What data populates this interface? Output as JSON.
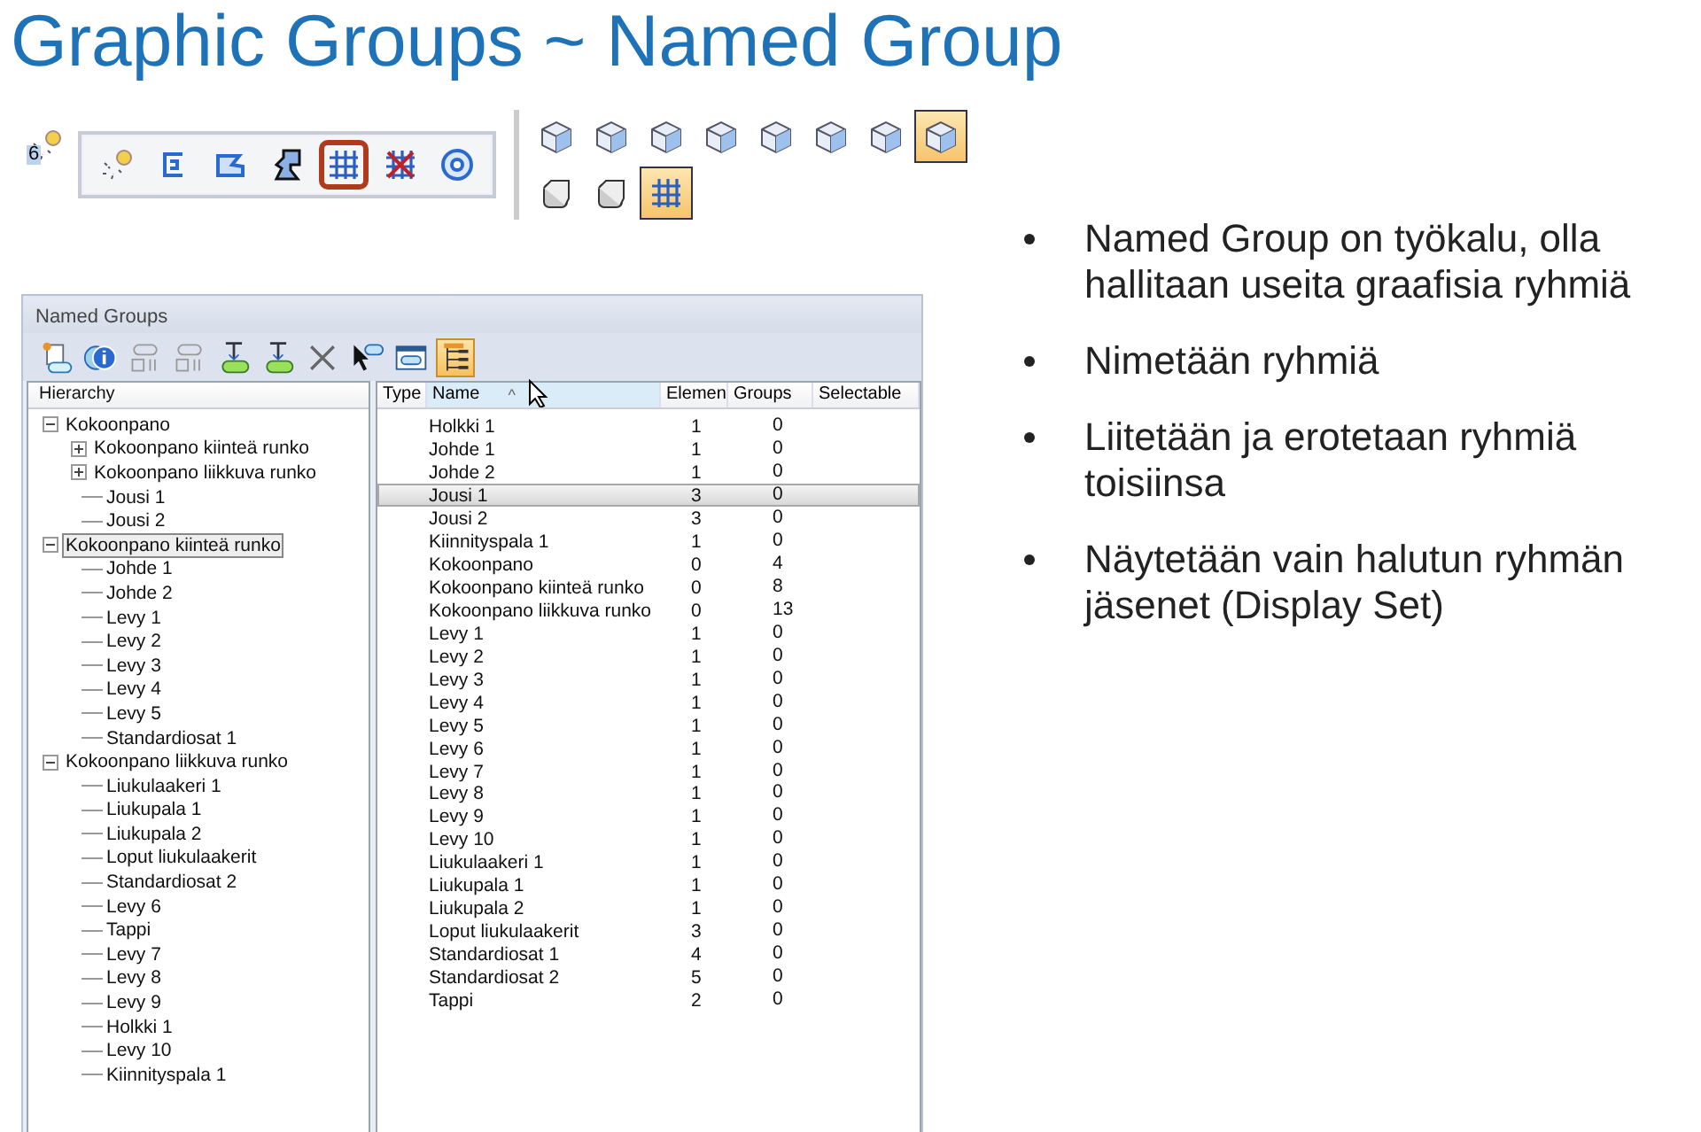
{
  "slide_title": "Graphic Groups ~ Named Group",
  "toolbar": {
    "badge": "6",
    "tools": [
      {
        "kind": "bulb",
        "selected": false
      },
      {
        "kind": "bracket",
        "selected": false
      },
      {
        "kind": "profile",
        "selected": false
      },
      {
        "kind": "figure",
        "selected": false
      },
      {
        "kind": "grid",
        "selected": true
      },
      {
        "kind": "grid-crossed",
        "selected": false
      },
      {
        "kind": "ring",
        "selected": false
      }
    ]
  },
  "view_palette": [
    {
      "kind": "cube",
      "selected": false
    },
    {
      "kind": "cube",
      "selected": false
    },
    {
      "kind": "cube",
      "selected": false
    },
    {
      "kind": "cube",
      "selected": false
    },
    {
      "kind": "cube",
      "selected": false
    },
    {
      "kind": "cube",
      "selected": false
    },
    {
      "kind": "cube",
      "selected": false
    },
    {
      "kind": "cube",
      "selected": true
    },
    {
      "kind": "rounded-cube",
      "selected": false
    },
    {
      "kind": "rounded-cube",
      "selected": false
    },
    {
      "kind": "grid",
      "selected": true
    }
  ],
  "window": {
    "title": "Named Groups",
    "toolbar": [
      {
        "kind": "new",
        "selected": false
      },
      {
        "kind": "info",
        "selected": false
      },
      {
        "kind": "links",
        "selected": false
      },
      {
        "kind": "links",
        "selected": false
      },
      {
        "kind": "add",
        "selected": false
      },
      {
        "kind": "add",
        "selected": false
      },
      {
        "kind": "delete",
        "selected": false
      },
      {
        "kind": "pointer",
        "selected": false
      },
      {
        "kind": "window",
        "selected": false
      },
      {
        "kind": "hierarchy",
        "selected": true
      }
    ],
    "tree": {
      "header": "Hierarchy",
      "items": [
        {
          "label": "Kokoonpano",
          "expanded": true,
          "selected": false,
          "children": [
            {
              "label": "Kokoonpano kiinteä runko",
              "expanded": false,
              "selected": false
            },
            {
              "label": "Kokoonpano liikkuva runko",
              "expanded": false,
              "selected": false
            },
            {
              "label": "Jousi 1",
              "selected": false
            },
            {
              "label": "Jousi 2",
              "selected": false
            }
          ]
        },
        {
          "label": "Kokoonpano kiinteä runko",
          "expanded": true,
          "selected": true,
          "children": [
            {
              "label": "Johde 1",
              "selected": false
            },
            {
              "label": "Johde 2",
              "selected": false
            },
            {
              "label": "Levy 1",
              "selected": false
            },
            {
              "label": "Levy 2",
              "selected": false
            },
            {
              "label": "Levy 3",
              "selected": false
            },
            {
              "label": "Levy 4",
              "selected": false
            },
            {
              "label": "Levy 5",
              "selected": false
            },
            {
              "label": "Standardiosat 1",
              "selected": false
            }
          ]
        },
        {
          "label": "Kokoonpano liikkuva runko",
          "expanded": true,
          "selected": false,
          "children": [
            {
              "label": "Liukulaakeri 1",
              "selected": false
            },
            {
              "label": "Liukupala 1",
              "selected": false
            },
            {
              "label": "Liukupala 2",
              "selected": false
            },
            {
              "label": "Loput liukulaakerit",
              "selected": false
            },
            {
              "label": "Standardiosat 2",
              "selected": false
            },
            {
              "label": "Levy 6",
              "selected": false
            },
            {
              "label": "Tappi",
              "selected": false
            },
            {
              "label": "Levy 7",
              "selected": false
            },
            {
              "label": "Levy 8",
              "selected": false
            },
            {
              "label": "Levy 9",
              "selected": false
            },
            {
              "label": "Holkki 1",
              "selected": false
            },
            {
              "label": "Levy 10",
              "selected": false
            },
            {
              "label": "Kiinnityspala 1",
              "selected": false
            }
          ]
        }
      ]
    },
    "table": {
      "columns": [
        {
          "label": "Type",
          "sorted": false
        },
        {
          "label": "Name",
          "sorted": true,
          "sort_mark": "^"
        },
        {
          "label": "Elemen",
          "sorted": false
        },
        {
          "label": "Groups",
          "sorted": false
        },
        {
          "label": "Selectable",
          "sorted": false
        }
      ],
      "rows": [
        {
          "name": "Holkki 1",
          "elements": "1",
          "groups": "0",
          "selected": false
        },
        {
          "name": "Johde 1",
          "elements": "1",
          "groups": "0",
          "selected": false
        },
        {
          "name": "Johde 2",
          "elements": "1",
          "groups": "0",
          "selected": false
        },
        {
          "name": "Jousi 1",
          "elements": "3",
          "groups": "0",
          "selected": true
        },
        {
          "name": "Jousi 2",
          "elements": "3",
          "groups": "0",
          "selected": false
        },
        {
          "name": "Kiinnityspala 1",
          "elements": "1",
          "groups": "0",
          "selected": false
        },
        {
          "name": "Kokoonpano",
          "elements": "0",
          "groups": "4",
          "selected": false
        },
        {
          "name": "Kokoonpano kiinteä runko",
          "elements": "0",
          "groups": "8",
          "selected": false
        },
        {
          "name": "Kokoonpano liikkuva runko",
          "elements": "0",
          "groups": "13",
          "selected": false
        },
        {
          "name": "Levy 1",
          "elements": "1",
          "groups": "0",
          "selected": false
        },
        {
          "name": "Levy 2",
          "elements": "1",
          "groups": "0",
          "selected": false
        },
        {
          "name": "Levy 3",
          "elements": "1",
          "groups": "0",
          "selected": false
        },
        {
          "name": "Levy 4",
          "elements": "1",
          "groups": "0",
          "selected": false
        },
        {
          "name": "Levy 5",
          "elements": "1",
          "groups": "0",
          "selected": false
        },
        {
          "name": "Levy 6",
          "elements": "1",
          "groups": "0",
          "selected": false
        },
        {
          "name": "Levy 7",
          "elements": "1",
          "groups": "0",
          "selected": false
        },
        {
          "name": "Levy 8",
          "elements": "1",
          "groups": "0",
          "selected": false
        },
        {
          "name": "Levy 9",
          "elements": "1",
          "groups": "0",
          "selected": false
        },
        {
          "name": "Levy 10",
          "elements": "1",
          "groups": "0",
          "selected": false
        },
        {
          "name": "Liukulaakeri 1",
          "elements": "1",
          "groups": "0",
          "selected": false
        },
        {
          "name": "Liukupala 1",
          "elements": "1",
          "groups": "0",
          "selected": false
        },
        {
          "name": "Liukupala 2",
          "elements": "1",
          "groups": "0",
          "selected": false
        },
        {
          "name": "Loput liukulaakerit",
          "elements": "3",
          "groups": "0",
          "selected": false
        },
        {
          "name": "Standardiosat 1",
          "elements": "4",
          "groups": "0",
          "selected": false
        },
        {
          "name": "Standardiosat 2",
          "elements": "5",
          "groups": "0",
          "selected": false
        },
        {
          "name": "Tappi",
          "elements": "2",
          "groups": "0",
          "selected": false
        }
      ]
    }
  },
  "bullets": [
    "Named Group on työkalu, olla hallitaan useita graafisia ryhmiä",
    "Nimetään ryhmiä",
    "Liitetään ja erotetaan ryhmiä toisiinsa",
    "Näytetään vain halutun ryhmän jäsenet (Display Set)"
  ]
}
